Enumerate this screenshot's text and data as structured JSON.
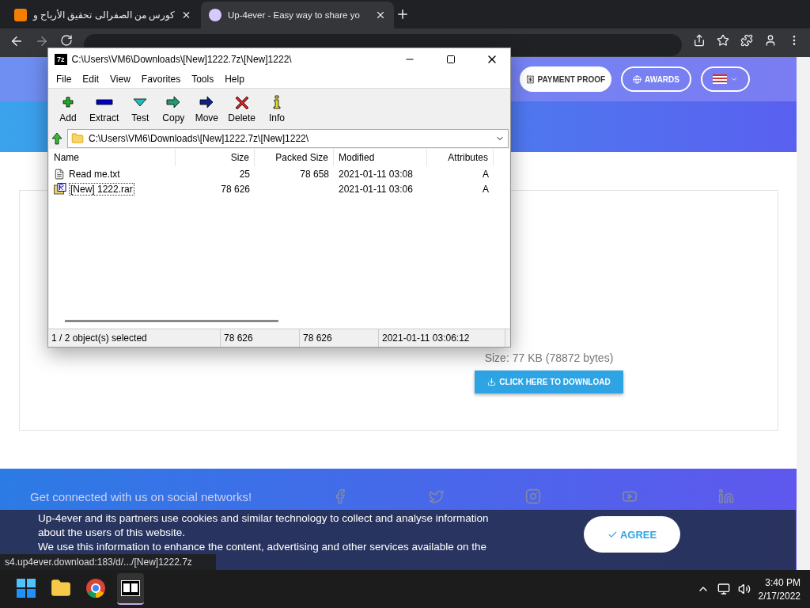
{
  "browser": {
    "tabs": [
      {
        "title": "كورس من الصفرالى تحقيق الأرباح و",
        "selected": false
      },
      {
        "title": "Up-4ever - Easy way to share yo",
        "selected": true
      }
    ]
  },
  "website": {
    "nav_buttons": [
      {
        "label": "PAYMENT PROOF",
        "kind": "receipt"
      },
      {
        "label": "AWARDS",
        "kind": "globe"
      },
      {
        "kind": "flag"
      }
    ],
    "file_size": "Size: 77 KB (78872 bytes)",
    "download_button": "CLICK HERE TO DOWNLOAD",
    "social_heading": "Get connected with us on social networks!",
    "cookie_text": [
      "Up-4ever and its partners use cookies and similar technology to collect and analyse information about the users of this website.",
      "We use this information to enhance the content, advertising and other services available on the"
    ],
    "agree_button": "AGREE"
  },
  "archive_window": {
    "logo": "7z",
    "title": "C:\\Users\\VM6\\Downloads\\[New]1222.7z\\[New]1222\\",
    "menu": [
      "File",
      "Edit",
      "View",
      "Favorites",
      "Tools",
      "Help"
    ],
    "toolbar": [
      {
        "label": "Add",
        "kind": "add"
      },
      {
        "label": "Extract",
        "kind": "extract"
      },
      {
        "label": "Test",
        "kind": "test"
      },
      {
        "label": "Copy",
        "kind": "copy"
      },
      {
        "label": "Move",
        "kind": "move"
      },
      {
        "label": "Delete",
        "kind": "delete"
      },
      {
        "label": "Info",
        "kind": "info"
      }
    ],
    "path": "C:\\Users\\VM6\\Downloads\\[New]1222.7z\\[New]1222\\",
    "columns": [
      "Name",
      "Size",
      "Packed Size",
      "Modified",
      "Attributes"
    ],
    "rows": [
      {
        "name": "Read me.txt",
        "size": "25",
        "packed_size": "78 658",
        "modified": "2021-01-11 03:08",
        "attributes": "A",
        "kind": "text",
        "selected": false
      },
      {
        "name": "[New] 1222.rar",
        "size": "78 626",
        "modified": "2021-01-11 03:06",
        "attributes": "A",
        "kind": "archive",
        "selected": true
      }
    ],
    "status": [
      "1 / 2 object(s) selected",
      "78 626",
      "78 626",
      "2021-01-11 03:06:12"
    ]
  },
  "status_url": "s4.up4ever.download:183/d/.../[New]1222.7z",
  "taskbar": {
    "apps": [
      {
        "kind": "start",
        "active": false
      },
      {
        "kind": "folder",
        "active": false
      },
      {
        "kind": "chrome",
        "active": false
      },
      {
        "kind": "sevenzip",
        "active": true
      }
    ],
    "time": "3:40 PM",
    "date": "2/17/2022"
  }
}
